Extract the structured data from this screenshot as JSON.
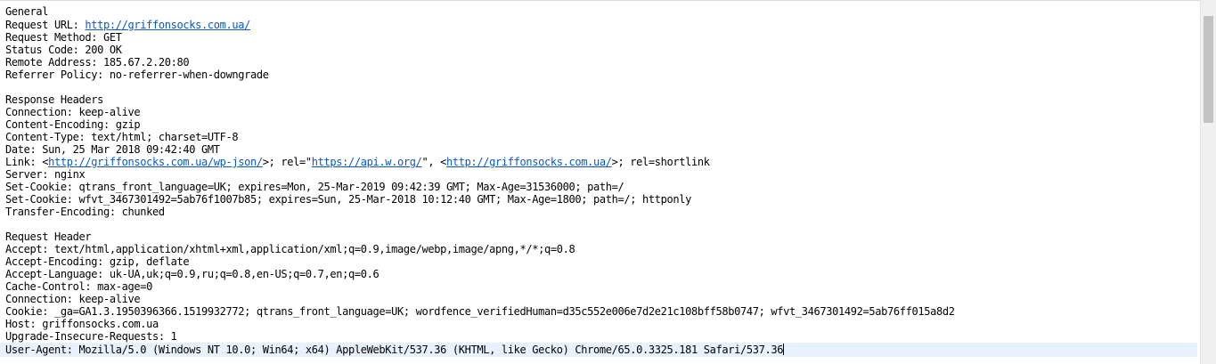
{
  "lines": {
    "l01": "General",
    "l02_prefix": "Request URL: ",
    "l02_link": "http://griffonsocks.com.ua/",
    "l03": "Request Method: GET",
    "l04": "Status Code: 200 OK",
    "l05": "Remote Address: 185.67.2.20:80",
    "l06": "Referrer Policy: no-referrer-when-downgrade",
    "l08": "Response Headers",
    "l09": "Connection: keep-alive",
    "l10": "Content-Encoding: gzip",
    "l11": "Content-Type: text/html; charset=UTF-8",
    "l12": "Date: Sun, 25 Mar 2018 09:42:40 GMT",
    "l13_a": "Link: <",
    "l13_link1": "http://griffonsocks.com.ua/wp-json/",
    "l13_b": ">; rel=\"",
    "l13_link2": "https://api.w.org/",
    "l13_c": "\", <",
    "l13_link3": "http://griffonsocks.com.ua/",
    "l13_d": ">; rel=shortlink",
    "l14": "Server: nginx",
    "l15": "Set-Cookie: qtrans_front_language=UK; expires=Mon, 25-Mar-2019 09:42:39 GMT; Max-Age=31536000; path=/",
    "l16": "Set-Cookie: wfvt_3467301492=5ab76f1007b85; expires=Sun, 25-Mar-2018 10:12:40 GMT; Max-Age=1800; path=/; httponly",
    "l17": "Transfer-Encoding: chunked",
    "l19": "Request Header",
    "l20": "Accept: text/html,application/xhtml+xml,application/xml;q=0.9,image/webp,image/apng,*/*;q=0.8",
    "l21": "Accept-Encoding: gzip, deflate",
    "l22": "Accept-Language: uk-UA,uk;q=0.9,ru;q=0.8,en-US;q=0.7,en;q=0.6",
    "l23": "Cache-Control: max-age=0",
    "l24": "Connection: keep-alive",
    "l25": "Cookie: _ga=GA1.3.1950396366.1519932772; qtrans_front_language=UK; wordfence_verifiedHuman=d35c552e006e7d2e21c108bff58b0747; wfvt_3467301492=5ab76ff015a8d2",
    "l26": "Host: griffonsocks.com.ua",
    "l27": "Upgrade-Insecure-Requests: 1",
    "l28": "User-Agent: Mozilla/5.0 (Windows NT 10.0; Win64; x64) AppleWebKit/537.36 (KHTML, like Gecko) Chrome/65.0.3325.181 Safari/537.36"
  }
}
